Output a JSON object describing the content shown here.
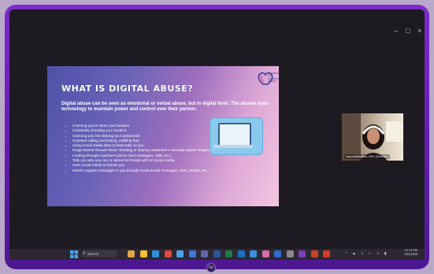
{
  "window": {
    "minimize": "–",
    "maximize": "□",
    "close": "×"
  },
  "slide": {
    "title": "WHAT IS DIGITAL ABUSE?",
    "logo_text": "ALTERNATIVES TO DOMESTIC ABUSE",
    "lead": "Digital abuse can be seen as emotional or verbal abuse, but in digital form. The abuser uses technology to maintain power and control over their partner.",
    "bullets": [
      "Coercing you to share your location",
      "Constantly checking your location",
      "Coercing you into sharing your passwords",
      "Constant calling and texting, instilling fear",
      "Using social media sites to keep tabs on you",
      "Image-Based Sexual Abuse: Sending or sharing unwanted or sexually explicit images without the victim's consent",
      "Looking through a partner's phone (text messages, calls, etc.)",
      "Tells you who you can or cannot be friends with on social media",
      "Uses social media to harass you",
      "Sends negative messages to you through social media messages, texts, emails, etc."
    ]
  },
  "webcam": {
    "name_label": "Laura Melendez, ADV (She/her)"
  },
  "taskbar": {
    "search_placeholder": "Search",
    "icon_names": [
      "widgets-icon",
      "file-explorer-icon",
      "edge-icon",
      "chrome-icon",
      "store-icon",
      "mail-icon",
      "teams-icon",
      "word-icon",
      "excel-icon",
      "outlook-icon",
      "calendar-icon",
      "photos-icon",
      "app-icon",
      "settings-icon",
      "onenote-icon",
      "powerpoint-icon",
      "acrobat-icon"
    ],
    "icon_colors": [
      "#e0a64a",
      "#f3c13a",
      "#2f8fd9",
      "#e24b3b",
      "#4aa3e8",
      "#3a7bd5",
      "#6264a7",
      "#2b5797",
      "#1f7a44",
      "#1a6fc2",
      "#3b8fe0",
      "#d66ca8",
      "#2f6ad0",
      "#8a8a8a",
      "#7b3fb3",
      "#c8452a",
      "#d23a2a"
    ],
    "clock_time": "12:12 PM",
    "clock_date": "1/21/2025"
  },
  "brand": {
    "mark": "hp"
  },
  "colors": {
    "frame": "#6a1fb8",
    "screen": "#1d1b21",
    "taskbar": "#2c2733"
  }
}
